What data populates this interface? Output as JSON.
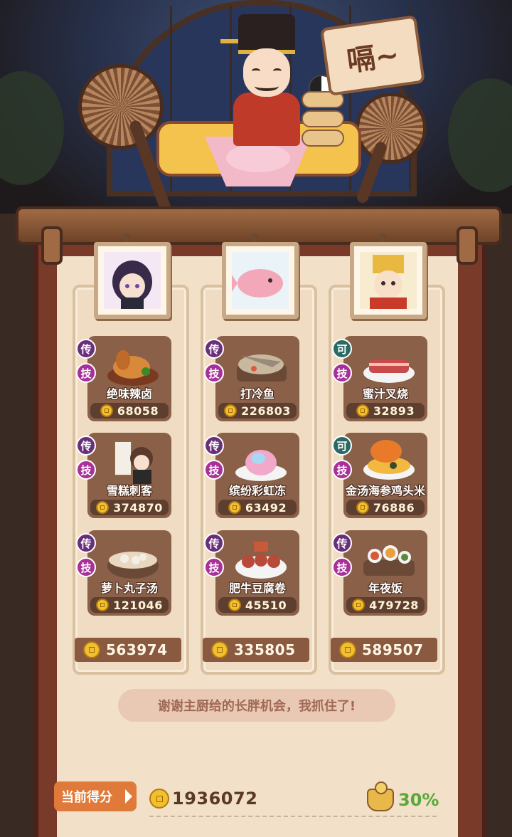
{
  "scene": {
    "speech": "嗝~"
  },
  "columns": [
    {
      "portrait": "chibi-girl-portrait",
      "dishes": [
        {
          "badge1": "传",
          "badge2": "技",
          "name": "绝味辣卤",
          "price": "68058"
        },
        {
          "badge1": "传",
          "badge2": "技",
          "name": "雪糕刺客",
          "price": "374870"
        },
        {
          "badge1": "传",
          "badge2": "技",
          "name": "萝卜丸子汤",
          "price": "121046"
        }
      ],
      "total": "563974"
    },
    {
      "portrait": "pink-fish-portrait",
      "dishes": [
        {
          "badge1": "传",
          "badge2": "技",
          "name": "打冷鱼",
          "price": "226803"
        },
        {
          "badge1": "传",
          "badge2": "技",
          "name": "缤纷彩虹冻",
          "price": "63492"
        },
        {
          "badge1": "传",
          "badge2": "技",
          "name": "肥牛豆腐卷",
          "price": "45510"
        }
      ],
      "total": "335805"
    },
    {
      "portrait": "deity-portrait",
      "dishes": [
        {
          "badge1": "可",
          "badge2": "技",
          "name": "蜜汁叉烧",
          "price": "32893"
        },
        {
          "badge1": "可",
          "badge2": "技",
          "name": "金汤海参鸡头米",
          "price": "76886"
        },
        {
          "badge1": "传",
          "badge2": "技",
          "name": "年夜饭",
          "price": "479728"
        }
      ],
      "total": "589507"
    }
  ],
  "quote": "谢谢主厨给的长胖机会，我抓住了!",
  "score": {
    "label": "当前得分",
    "total": "1936072",
    "bonus": "30%"
  },
  "colors": {
    "badge_legend": "#6a2f7a",
    "badge_skill": "#a8309a",
    "badge_teal": "#2a6a64",
    "bonus_green": "#5aa83a",
    "score_orange": "#e07a3a"
  }
}
